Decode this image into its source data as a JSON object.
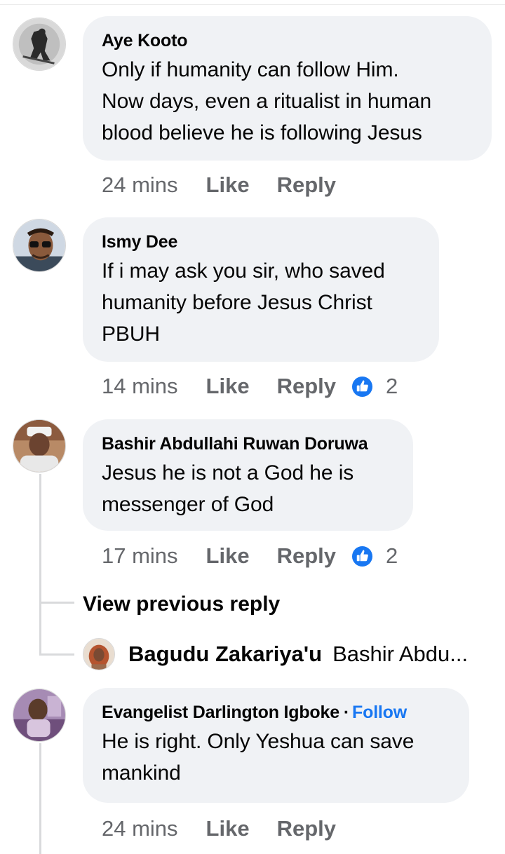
{
  "comments": [
    {
      "author": "Aye Kooto",
      "text": [
        "Only if humanity  can follow Him.",
        "Now days, even a ritualist in human",
        "blood believe he is following  Jesus"
      ],
      "time": "24 mins",
      "like_label": "Like",
      "reply_label": "Reply",
      "avatar": "avatar-photo"
    },
    {
      "author": "Ismy Dee",
      "text": [
        "If i may ask you sir, who saved",
        "humanity before Jesus Christ",
        "PBUH"
      ],
      "time": "14 mins",
      "like_label": "Like",
      "reply_label": "Reply",
      "reaction_count": "2",
      "avatar": "avatar-photo"
    },
    {
      "author": "Bashir Abdullahi Ruwan Doruwa",
      "text": [
        "Jesus he is not a God he is",
        "messenger of God"
      ],
      "time": "17 mins",
      "like_label": "Like",
      "reply_label": "Reply",
      "reaction_count": "2",
      "avatar": "avatar-photo"
    },
    {
      "author": "Evangelist Darlington Igboke",
      "separator": "·",
      "follow_label": "Follow",
      "text": [
        "He is right. Only Yeshua can save",
        "mankind"
      ],
      "time": "24 mins",
      "like_label": "Like",
      "reply_label": "Reply",
      "avatar": "avatar-photo"
    }
  ],
  "thread": {
    "view_previous_label": "View previous reply",
    "reply_preview": {
      "author": "Bagudu Zakariya'u",
      "text": "Bashir Abdu..."
    }
  },
  "colors": {
    "bubble_bg": "#f0f2f5",
    "muted_text": "#65676b",
    "accent_blue": "#1877f2",
    "thread_line": "#d9dadc"
  },
  "icons": {
    "reaction": "like-thumbs-up-icon"
  }
}
